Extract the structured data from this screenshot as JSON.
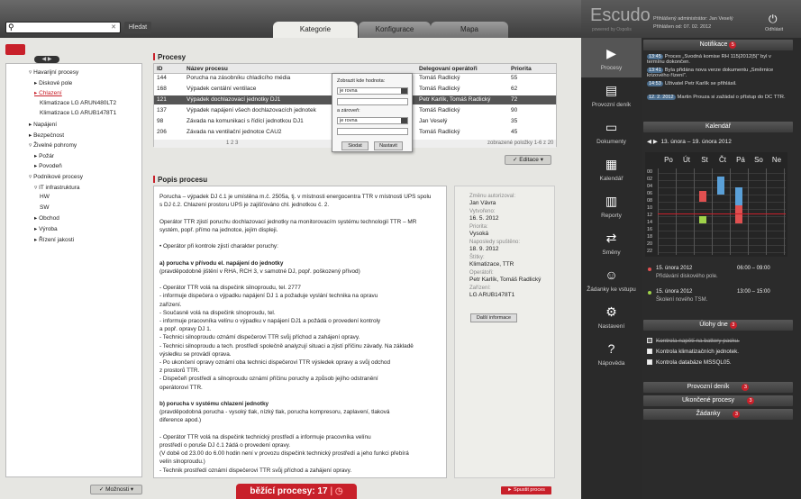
{
  "search": {
    "placeholder": "",
    "button": "Hledat"
  },
  "tabs": [
    {
      "label": "Kategorie",
      "active": true
    },
    {
      "label": "Konfigurace",
      "active": false
    },
    {
      "label": "Mapa",
      "active": false
    }
  ],
  "brand": {
    "name": "Escudo",
    "sub": "powered by Oxpolis"
  },
  "login": {
    "admin": "Přihlášený administrátor: Jan Veselý",
    "since": "Přihlášen od: 07. 02. 2012",
    "logout": "Odhlásit"
  },
  "tree": [
    {
      "label": "Havarijní procesy",
      "level": 0,
      "expanded": true
    },
    {
      "label": "Diskové pole",
      "level": 1
    },
    {
      "label": "Chlazení",
      "level": 1,
      "selected": true
    },
    {
      "label": "Klimatizace LG ARUN480LT2",
      "level": 2
    },
    {
      "label": "Klimatizace LG ARUB1478T1",
      "level": 2
    },
    {
      "label": "Napájení",
      "level": 0
    },
    {
      "label": "Bezpečnost",
      "level": 0
    },
    {
      "label": "Živelné pohromy",
      "level": 0,
      "expanded": true
    },
    {
      "label": "Požár",
      "level": 1
    },
    {
      "label": "Povodeň",
      "level": 1
    },
    {
      "label": "Podnikové procesy",
      "level": 0,
      "expanded": true
    },
    {
      "label": "IT infrastruktura",
      "level": 1,
      "expanded": true
    },
    {
      "label": "HW",
      "level": 2
    },
    {
      "label": "SW",
      "level": 2
    },
    {
      "label": "Obchod",
      "level": 1
    },
    {
      "label": "Výroba",
      "level": 1
    },
    {
      "label": "Řízení jakosti",
      "level": 1
    }
  ],
  "moznosti": "✓ Možnosti ▾",
  "processes": {
    "title": "Procesy",
    "headers": {
      "id": "ID",
      "name": "Název procesu",
      "operators": "Delegovaní operátoři",
      "priority": "Priorita"
    },
    "rows": [
      {
        "id": "144",
        "name": "Porucha na zásobníku chladicího média",
        "operators": "Tomáš Radlický",
        "priority": "55",
        "selected": false
      },
      {
        "id": "168",
        "name": "Výpadek centální ventilace",
        "operators": "Tomáš Radlický",
        "priority": "62",
        "selected": false
      },
      {
        "id": "121",
        "name": "Výpadek dochlazovací jednotky DJ1",
        "operators": "Petr Karlík, Tomáš Radlický",
        "priority": "72",
        "selected": true
      },
      {
        "id": "137",
        "name": "Výpadek napájení všech dochlazovacích jednotek",
        "operators": "Tomáš Radlický",
        "priority": "90",
        "selected": false
      },
      {
        "id": "98",
        "name": "Závada na komunikaci s řídící jednotkou DJ1",
        "operators": "Jan Veselý",
        "priority": "35",
        "selected": false
      },
      {
        "id": "206",
        "name": "Závada na ventilační jednotce CAU2",
        "operators": "Tomáš Radlický",
        "priority": "45",
        "selected": false
      }
    ],
    "pagination": "1 2 3",
    "summary": "zobrazené položky 1-6 z 20",
    "edit": "✓ Editace ▾"
  },
  "filter": {
    "label1": "Zobrazit kde hodnota:",
    "op1": "je rovna",
    "label2": "a zároveň:",
    "op2": "je rovna",
    "apply": "Siodat",
    "reset": "Nastavit"
  },
  "description": {
    "title": "Popis procesu",
    "lines": [
      "Porucha – výpadek DJ č.1 je umístěna  m.č. 2505a, tj. v místnosti energocentra TTR v místnosti UPS spolu",
      "s DJ č.2. Chlazení prostoru UPS je zajišťováno chl. jednotkou č. 2.",
      "",
      "Operátor TTR zjistí poruchu dochlazovací jednotky na monitorovacím systému technologií TTR – MR",
      "systém, popř. přímo na jednotce, jejím displeji.",
      "",
      "• Operátor při kontrole zjistí charakter poruchy:",
      "",
      "a) porucha v přívodu el. napájení do jednotky",
      "   (pravděpodobně jištění v RHA, RCH 3, v samotné DJ, popř. poškozený přívod)",
      "",
      "        - Operátor TTR volá na dispečink silnoproudu, tel. 2777",
      "        - informuje dispečera o výpadku napájení DJ 1 a požaduje vyslání technika na opravu",
      "          zařízení.",
      "        - Současně volá na dispečink slnoproudu, tel.",
      "        - informuje pracovníka velínu o výpadku v napájení DJ1 a požádá o provedení kontroly",
      "          a popř. opravy DJ 1.",
      "        - Technici silnoproudu oznámí dispečerovi TTR svůj příchod a zahájení opravy.",
      "        - Technici silnoproudu a tech. prostředí společně analyzují situaci a zjistí příčinu závady.  Na základě",
      "          výsledku se  provádí oprava.",
      "        - Po ukončení opravy oznámí oba technici dispečerovi TTR výsledek opravy a svůj odchod",
      "          z prostorů TTR.",
      "        - Dispečeři prostředí a silnoproudu oznámí příčinu poruchy a způsob jejího odstranění",
      "          operátorovi TTR.",
      "",
      "b) porucha v systému chlazení jednotky",
      "   (pravděpodobná porucha - vysoký tlak, nízký tlak, porucha kompresoru, zaplavení, tlaková",
      "   diference apod.)",
      "",
      "        - Operátor TTR volá na dispečink technický prostředí a informuje pracovníka velínu",
      "          prostředí o poruše DJ č.1 žádá o provedení opravy.",
      "          (V době od 23.00 do 6.00 hodin není v provozu dispečink technický prostředí a jeho funkci přebírá",
      "          velín slnoproudu.)",
      "        - Technik prostředí oznámí dispečerovi TTR svůj příchod a zahájení opravy."
    ]
  },
  "meta": [
    {
      "key": "Změnu autorizoval:",
      "value": "Jan Vávra"
    },
    {
      "key": "Vytvořeno:",
      "value": "16. 5. 2012"
    },
    {
      "key": "Priorita:",
      "value": "Vysoká"
    },
    {
      "key": "Naposledy spuštěno:",
      "value": "18. 9. 2012"
    },
    {
      "key": "Štítky:",
      "value": "Klimatizace, TTR"
    },
    {
      "key": "Operátoři:",
      "value": "Petr Karlík, Tomáš Radlický"
    },
    {
      "key": "Zařízení:",
      "value": "LG ARUB1478T1"
    }
  ],
  "more_info": "Další informace",
  "running": {
    "label": "běžící procesy:",
    "count": "17"
  },
  "start_process": "► Spustit proces",
  "dock": [
    {
      "label": "Procesy",
      "icon": "▶"
    },
    {
      "label": "Provozní deník",
      "icon": "▤"
    },
    {
      "label": "Dokumenty",
      "icon": "▭"
    },
    {
      "label": "Kalendář",
      "icon": "▦"
    },
    {
      "label": "Reporty",
      "icon": "▥"
    },
    {
      "label": "Směny",
      "icon": "⇄"
    },
    {
      "label": "Žádanky ke vstupu",
      "icon": "☺"
    },
    {
      "label": "Nastavení",
      "icon": "⚙"
    },
    {
      "label": "Nápověda",
      "icon": "?"
    }
  ],
  "notifications": {
    "title": "Notifikace",
    "count": "5",
    "items": [
      {
        "time": "13:45",
        "text": "Proces „Svodná komise RH 115|2012|5|“ byl v termínu dokončen."
      },
      {
        "time": "13:41",
        "text": "Byla přidána nova verze dokumentu „Směrnice krizového řízení“."
      },
      {
        "time": "14:53",
        "text": "Uživatel Petr Karlík se přihlásil."
      },
      {
        "time": "12. 2. 2012",
        "text": "Martin Prouza si zažádal o přístup do DC TTR."
      }
    ]
  },
  "calendar": {
    "title": "Kalendář",
    "range": "13. února – 19. února 2012",
    "days": [
      "Po",
      "Út",
      "St",
      "Čt",
      "Pá",
      "So",
      "Ne"
    ],
    "hours": [
      "00",
      "02",
      "04",
      "06",
      "08",
      "10",
      "12",
      "14",
      "16",
      "18",
      "20",
      "22"
    ],
    "events": [
      {
        "date": "15. února 2012",
        "time": "06:00 – 09:00",
        "title": "Přidávání diskového pole.",
        "color": "#e05050"
      },
      {
        "date": "15. února 2012",
        "time": "13:00 – 15:00",
        "title": "Školení nového TSM.",
        "color": "#9fd24a"
      }
    ]
  },
  "tasks": {
    "title": "Úlohy dne",
    "count": "3",
    "items": [
      {
        "label": "Kontrola napětí na battery packu.",
        "done": true
      },
      {
        "label": "Kontrola klimatizačních jednotek.",
        "done": false
      },
      {
        "label": "Kontrola databáze MSSQL05.",
        "done": false
      }
    ]
  },
  "collapsed": [
    {
      "title": "Provozní deník",
      "count": "3"
    },
    {
      "title": "Ukončené procesy",
      "count": "3"
    },
    {
      "title": "Žádanky",
      "count": "3"
    }
  ],
  "colors": {
    "accent": "#c8202a",
    "dark": "#2b2b2b",
    "event_red": "#e05050",
    "event_green": "#9fd24a",
    "event_blue": "#5aa0d8"
  }
}
